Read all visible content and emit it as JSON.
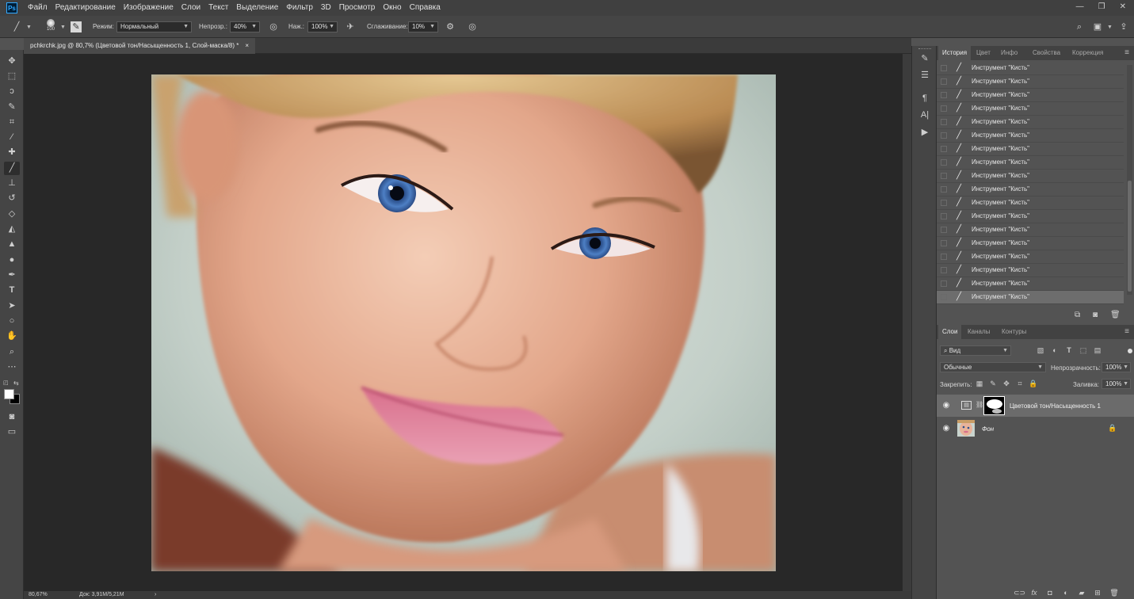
{
  "app": {
    "logo": "Ps",
    "menu": [
      "Файл",
      "Редактирование",
      "Изображение",
      "Слои",
      "Текст",
      "Выделение",
      "Фильтр",
      "3D",
      "Просмотр",
      "Окно",
      "Справка"
    ],
    "window_controls": [
      "minimize-icon",
      "restore-icon",
      "close-icon"
    ],
    "window_control_glyphs": [
      "—",
      "❐",
      "✕"
    ]
  },
  "options": {
    "brush_size": "100",
    "mode_label": "Режим:",
    "mode_value": "Нормальный",
    "opacity_label": "Непрозр.:",
    "opacity_value": "40%",
    "flow_label": "Наж.:",
    "flow_value": "100%",
    "smoothing_label": "Сглаживание:",
    "smoothing_value": "10%"
  },
  "document": {
    "tab_title": "pchkrchk.jpg @ 80,7% (Цветовой тон/Насыщенность 1, Слой-маска/8) *",
    "tab_close": "×",
    "zoom": "80,67%",
    "doc_size": "Док: 3,91M/5,21M",
    "status_arrow": "›"
  },
  "tools": [
    {
      "name": "move-tool-icon",
      "glyph": "✥"
    },
    {
      "name": "marquee-tool-icon",
      "glyph": "⬚"
    },
    {
      "name": "lasso-tool-icon",
      "glyph": "ↄ"
    },
    {
      "name": "quick-select-tool-icon",
      "glyph": "✎"
    },
    {
      "name": "crop-tool-icon",
      "glyph": "⌗"
    },
    {
      "name": "eyedropper-tool-icon",
      "glyph": "⁄"
    },
    {
      "name": "healing-brush-tool-icon",
      "glyph": "✚"
    },
    {
      "name": "brush-tool-icon",
      "glyph": "╱"
    },
    {
      "name": "stamp-tool-icon",
      "glyph": "⊥"
    },
    {
      "name": "history-brush-tool-icon",
      "glyph": "↺"
    },
    {
      "name": "eraser-tool-icon",
      "glyph": "◇"
    },
    {
      "name": "paint-bucket-tool-icon",
      "glyph": "◭"
    },
    {
      "name": "sharpen-tool-icon",
      "glyph": "▲"
    },
    {
      "name": "dodge-tool-icon",
      "glyph": "●"
    },
    {
      "name": "pen-tool-icon",
      "glyph": "✒"
    },
    {
      "name": "type-tool-icon",
      "glyph": "T"
    },
    {
      "name": "path-select-tool-icon",
      "glyph": "➤"
    },
    {
      "name": "ellipse-tool-icon",
      "glyph": "○"
    },
    {
      "name": "hand-tool-icon",
      "glyph": "✋"
    },
    {
      "name": "zoom-tool-icon",
      "glyph": "⌕"
    },
    {
      "name": "more-tools-icon",
      "glyph": "⋯"
    }
  ],
  "strip_icons": [
    {
      "name": "brush-settings-icon",
      "glyph": "✎"
    },
    {
      "name": "adjustments-icon",
      "glyph": "☰"
    },
    {
      "name": "paragraph-icon",
      "glyph": "¶"
    },
    {
      "name": "character-icon",
      "glyph": "A|"
    },
    {
      "name": "actions-play-icon",
      "glyph": "▶"
    }
  ],
  "history_panel": {
    "tabs": [
      "История",
      "Цвет",
      "Инфо",
      "Свойства",
      "Коррекция"
    ],
    "items": [
      "Инструмент \"Кисть\"",
      "Инструмент \"Кисть\"",
      "Инструмент \"Кисть\"",
      "Инструмент \"Кисть\"",
      "Инструмент \"Кисть\"",
      "Инструмент \"Кисть\"",
      "Инструмент \"Кисть\"",
      "Инструмент \"Кисть\"",
      "Инструмент \"Кисть\"",
      "Инструмент \"Кисть\"",
      "Инструмент \"Кисть\"",
      "Инструмент \"Кисть\"",
      "Инструмент \"Кисть\"",
      "Инструмент \"Кисть\"",
      "Инструмент \"Кисть\"",
      "Инструмент \"Кисть\"",
      "Инструмент \"Кисть\"",
      "Инструмент \"Кисть\""
    ],
    "current_index": 17
  },
  "layers_panel": {
    "tabs": [
      "Слои",
      "Каналы",
      "Контуры"
    ],
    "filter_value": "Вид",
    "filter_glyph": "⌕",
    "blend_mode": "Обычные",
    "opacity_label": "Непрозрачность:",
    "opacity_value": "100%",
    "lock_label": "Закрепить:",
    "fill_label": "Заливка:",
    "fill_value": "100%",
    "layers": [
      {
        "name": "Цветовой тон/Насыщенность 1",
        "selected": true
      },
      {
        "name": "Фон",
        "selected": false
      }
    ]
  }
}
